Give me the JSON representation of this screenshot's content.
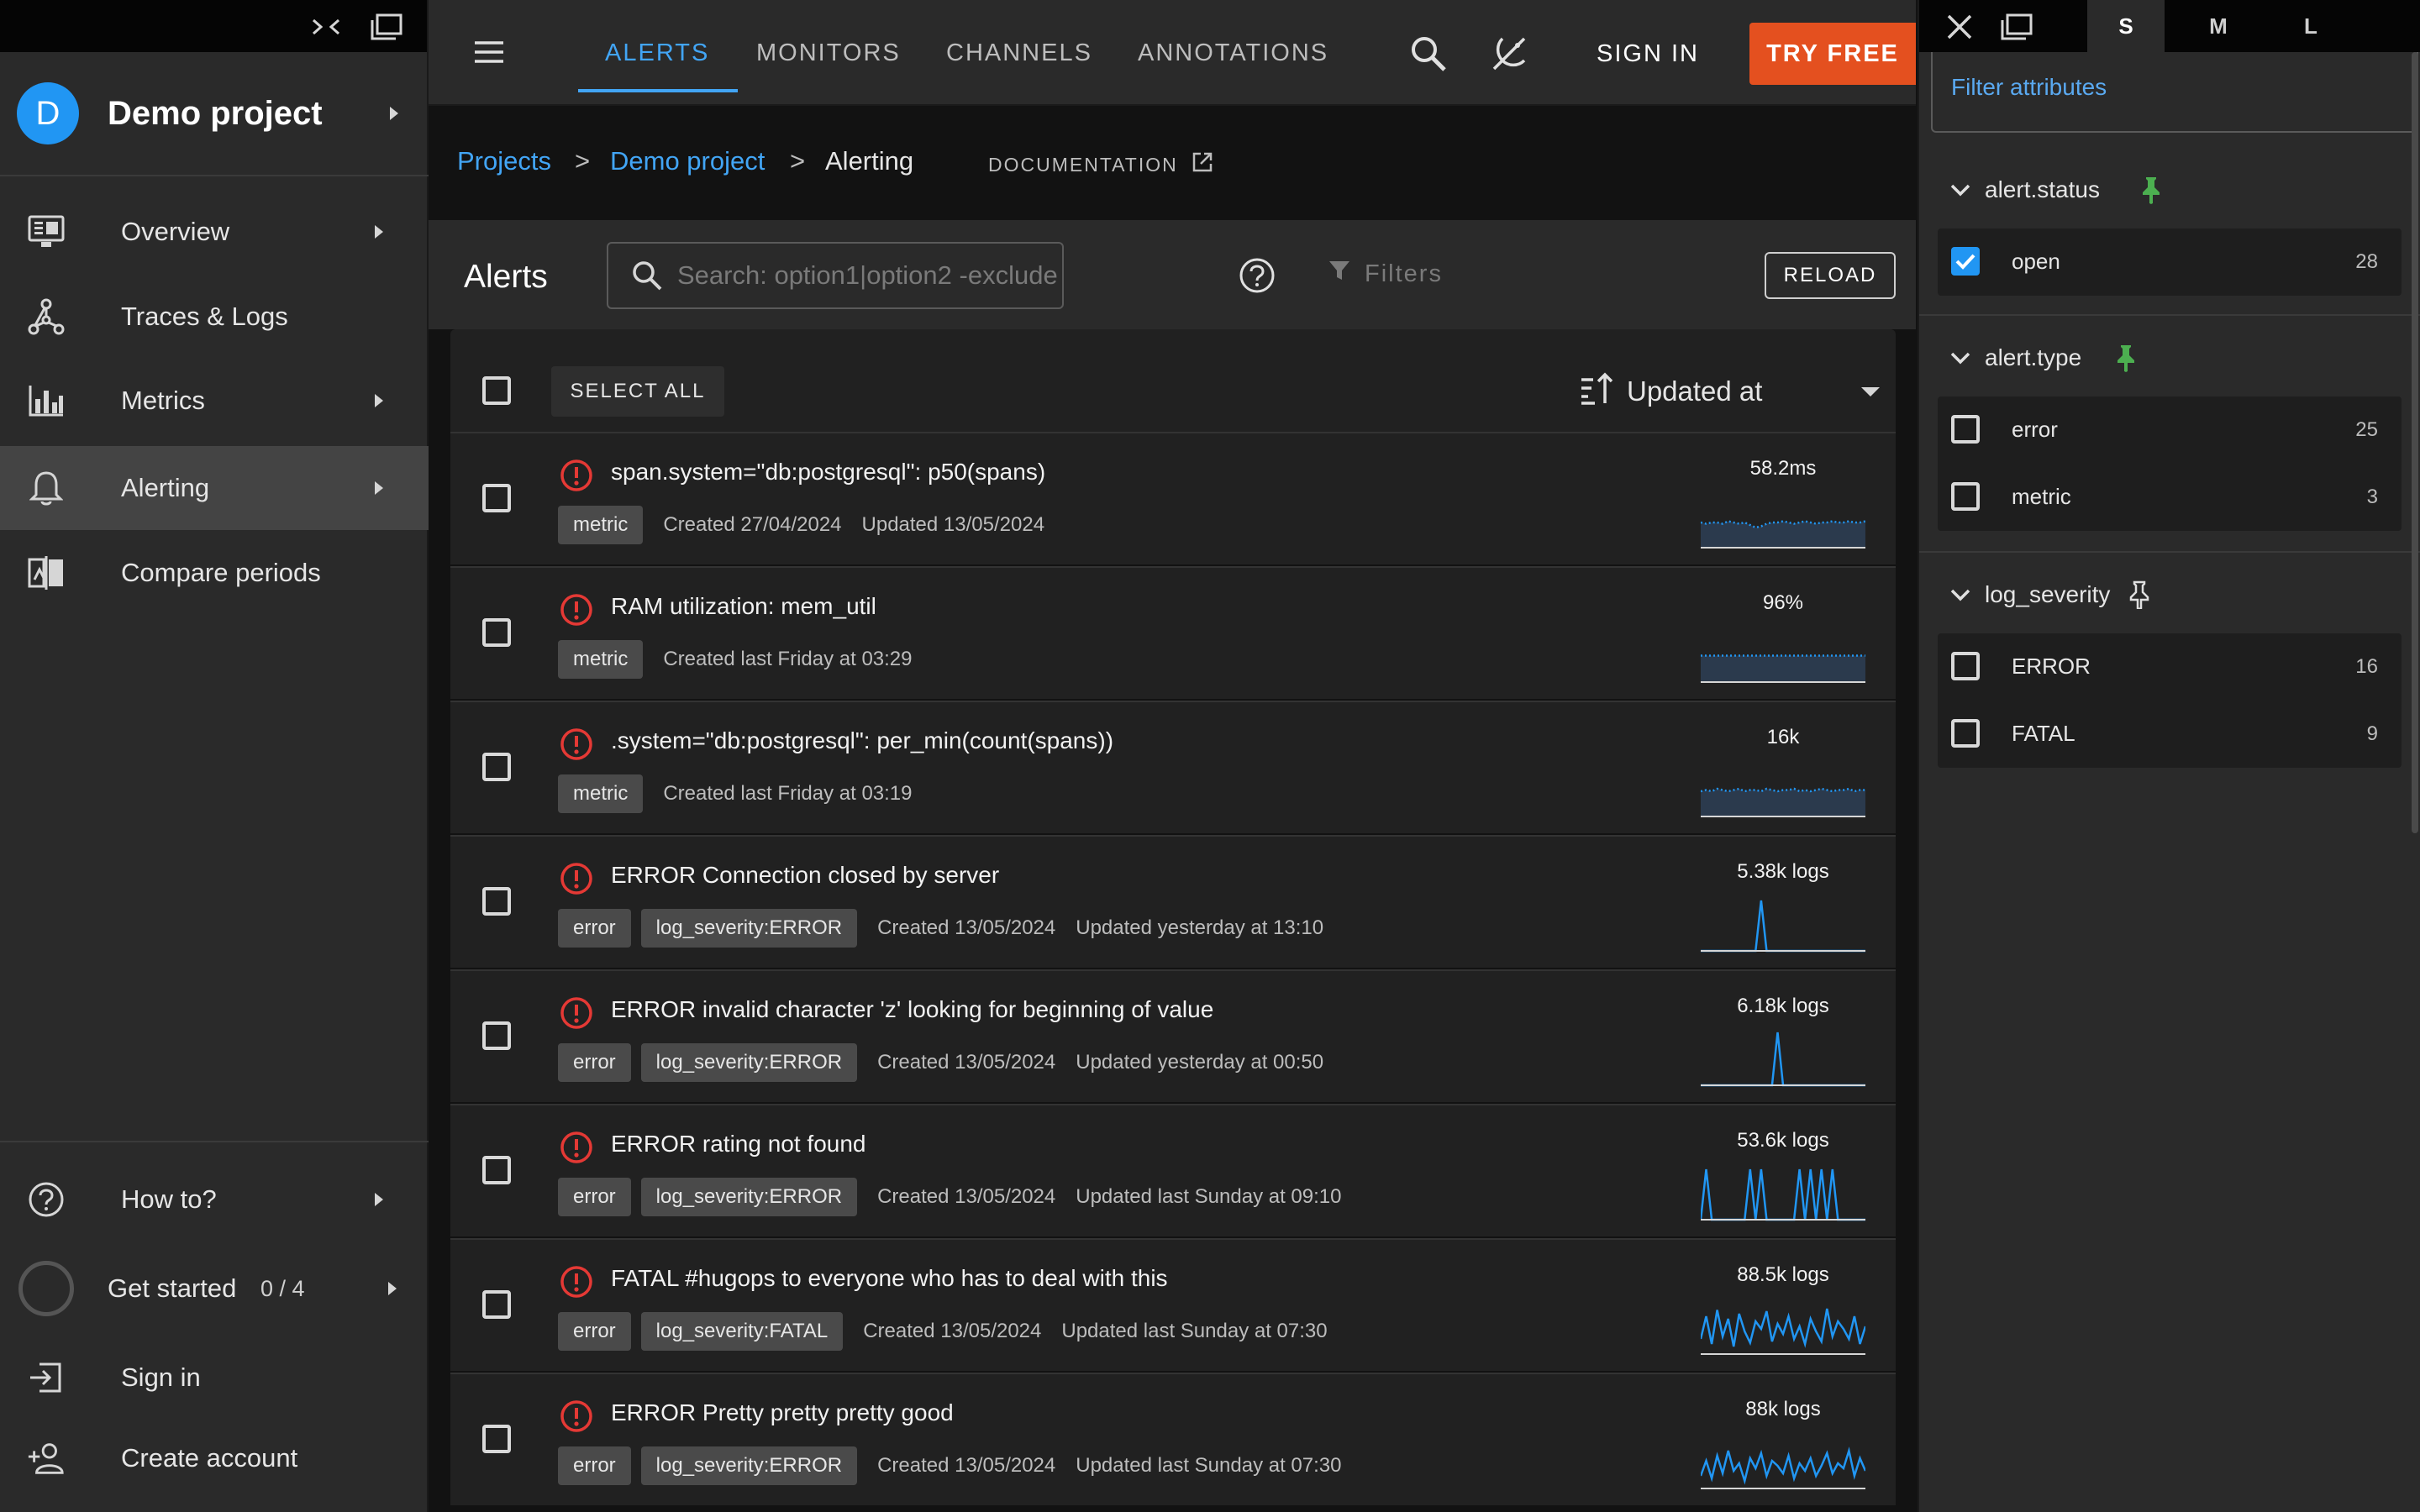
{
  "sidebar": {
    "project_initial": "D",
    "project_name": "Demo project",
    "nav": [
      {
        "label": "Overview"
      },
      {
        "label": "Traces & Logs"
      },
      {
        "label": "Metrics"
      },
      {
        "label": "Alerting"
      },
      {
        "label": "Compare periods"
      }
    ],
    "bottom": [
      {
        "label": "How to?"
      },
      {
        "label": "Get started",
        "progress": "0 / 4"
      },
      {
        "label": "Sign in"
      },
      {
        "label": "Create account"
      }
    ]
  },
  "topbar": {
    "tabs": [
      "ALERTS",
      "MONITORS",
      "CHANNELS",
      "ANNOTATIONS"
    ],
    "active_tab": "ALERTS",
    "sign_in": "SIGN IN",
    "try_free": "TRY FREE"
  },
  "breadcrumb": {
    "items": [
      "Projects",
      "Demo project",
      "Alerting"
    ],
    "separator": ">",
    "documentation": "DOCUMENTATION"
  },
  "alerts_toolbar": {
    "title": "Alerts",
    "search_placeholder": "Search: option1|option2 -exclude",
    "filters": "Filters",
    "reload": "RELOAD"
  },
  "list": {
    "select_all": "SELECT ALL",
    "sort_label": "Updated at",
    "rows": [
      {
        "title": "span.system=\"db:postgresql\": p50(spans)",
        "tags": [
          "metric"
        ],
        "created": "Created 27/04/2024",
        "updated": "Updated 13/05/2024",
        "spark_value": "58.2ms",
        "spark_kind": "area",
        "spark": [
          20,
          19,
          20,
          20,
          19,
          21,
          20,
          19,
          20,
          18,
          16,
          17,
          19,
          20,
          20,
          21,
          20,
          19,
          20,
          21,
          20,
          19,
          20,
          20,
          21,
          20,
          20,
          21,
          20,
          20,
          21
        ]
      },
      {
        "title": "RAM utilization: mem_util",
        "tags": [
          "metric"
        ],
        "created": "Created last Friday at 03:29",
        "updated": "",
        "spark_value": "96%",
        "spark_kind": "area",
        "spark": [
          21,
          21,
          21,
          21,
          21,
          21,
          21,
          21,
          21,
          21,
          21,
          21,
          21,
          21,
          21,
          21,
          21,
          21,
          21,
          21,
          21,
          21,
          21,
          21,
          21,
          21,
          21,
          21,
          21,
          21,
          21
        ]
      },
      {
        "title": ".system=\"db:postgresql\": per_min(count(spans))",
        "tags": [
          "metric"
        ],
        "created": "Created last Friday at 03:19",
        "updated": "",
        "spark_value": "16k",
        "spark_kind": "area",
        "spark": [
          20,
          21,
          20,
          22,
          21,
          20,
          21,
          22,
          20,
          21,
          21,
          20,
          22,
          21,
          20,
          21,
          21,
          22,
          20,
          21,
          20,
          21,
          22,
          21,
          20,
          21,
          21,
          22,
          20,
          21,
          21
        ]
      },
      {
        "title": "ERROR Connection closed by server",
        "tags": [
          "error",
          "log_severity:ERROR"
        ],
        "created": "Created 13/05/2024",
        "updated": "Updated yesterday at 13:10",
        "spark_value": "5.38k logs",
        "spark_kind": "line",
        "spark": [
          0,
          0,
          0,
          0,
          0,
          0,
          0,
          0,
          0,
          0,
          0,
          40,
          0,
          0,
          0,
          0,
          0,
          0,
          0,
          0,
          0,
          0,
          0,
          0,
          0,
          0,
          0,
          0,
          0,
          0,
          0
        ]
      },
      {
        "title": "ERROR invalid character 'z' looking for beginning of value",
        "tags": [
          "error",
          "log_severity:ERROR"
        ],
        "created": "Created 13/05/2024",
        "updated": "Updated yesterday at 00:50",
        "spark_value": "6.18k logs",
        "spark_kind": "line",
        "spark": [
          0,
          0,
          0,
          0,
          0,
          0,
          0,
          0,
          0,
          0,
          0,
          0,
          0,
          0,
          42,
          0,
          0,
          0,
          0,
          0,
          0,
          0,
          0,
          0,
          0,
          0,
          0,
          0,
          0,
          0,
          0
        ]
      },
      {
        "title": "ERROR rating not found",
        "tags": [
          "error",
          "log_severity:ERROR"
        ],
        "created": "Created 13/05/2024",
        "updated": "Updated last Sunday at 09:10",
        "spark_value": "53.6k logs",
        "spark_kind": "line",
        "spark": [
          0,
          40,
          0,
          0,
          0,
          0,
          0,
          0,
          0,
          40,
          0,
          40,
          0,
          0,
          0,
          0,
          0,
          0,
          40,
          0,
          40,
          0,
          40,
          0,
          40,
          0,
          0,
          0,
          0,
          0,
          0
        ]
      },
      {
        "title": "FATAL #hugops to everyone who has to deal with this",
        "tags": [
          "error",
          "log_severity:FATAL"
        ],
        "created": "Created 13/05/2024",
        "updated": "Updated last Sunday at 07:30",
        "spark_value": "88.5k logs",
        "spark_kind": "line",
        "spark": [
          12,
          30,
          8,
          35,
          14,
          28,
          6,
          32,
          18,
          9,
          26,
          20,
          34,
          10,
          24,
          16,
          30,
          12,
          22,
          8,
          28,
          18,
          10,
          36,
          14,
          26,
          20,
          12,
          30,
          8,
          22
        ]
      },
      {
        "title": "ERROR Pretty pretty pretty good",
        "tags": [
          "error",
          "log_severity:ERROR"
        ],
        "created": "Created 13/05/2024",
        "updated": "Updated last Sunday at 07:30",
        "spark_value": "88k logs",
        "spark_kind": "line",
        "spark": [
          10,
          22,
          8,
          26,
          12,
          30,
          14,
          20,
          6,
          24,
          16,
          28,
          10,
          22,
          18,
          12,
          26,
          8,
          20,
          14,
          24,
          10,
          18,
          28,
          12,
          20,
          16,
          30,
          10,
          24,
          14
        ]
      }
    ]
  },
  "panel": {
    "size_tabs": [
      "S",
      "M",
      "L"
    ],
    "active_size": "S",
    "filter_placeholder": "Filter attributes",
    "groups": [
      {
        "name": "alert.status",
        "pinned": true,
        "options": [
          {
            "label": "open",
            "count": "28",
            "checked": true
          }
        ]
      },
      {
        "name": "alert.type",
        "pinned": true,
        "options": [
          {
            "label": "error",
            "count": "25",
            "checked": false
          },
          {
            "label": "metric",
            "count": "3",
            "checked": false
          }
        ]
      },
      {
        "name": "log_severity",
        "pinned": false,
        "options": [
          {
            "label": "ERROR",
            "count": "16",
            "checked": false
          },
          {
            "label": "FATAL",
            "count": "9",
            "checked": false
          }
        ]
      }
    ]
  },
  "colors": {
    "accent": "#42a5f5",
    "cta": "#e4501f",
    "error": "#e53935",
    "pin": "#4caf50",
    "spark": "#2196f3"
  },
  "icons": [
    "collapse-icon",
    "window-icon",
    "monitor-icon",
    "network-icon",
    "bar-chart-icon",
    "bell-icon",
    "compare-icon",
    "menu-icon",
    "search-icon",
    "theme-icon",
    "external-link-icon",
    "help-icon",
    "filter-icon",
    "sort-icon",
    "alert-icon",
    "close-icon",
    "chevron-down-icon",
    "pin-icon",
    "sign-in-icon",
    "add-person-icon"
  ]
}
